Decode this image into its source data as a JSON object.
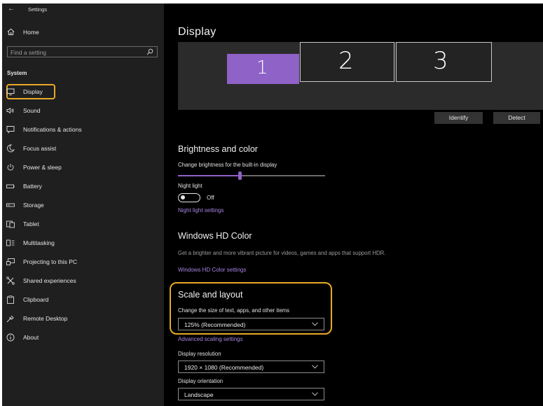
{
  "app": {
    "title": "Settings",
    "back_glyph": "←"
  },
  "sidebar": {
    "home_label": "Home",
    "search_placeholder": "Find a setting",
    "section_label": "System",
    "items": [
      {
        "label": "Display",
        "icon": "monitor-icon",
        "active": true
      },
      {
        "label": "Sound",
        "icon": "speaker-icon"
      },
      {
        "label": "Notifications & actions",
        "icon": "notification-icon"
      },
      {
        "label": "Focus assist",
        "icon": "moon-icon"
      },
      {
        "label": "Power & sleep",
        "icon": "power-icon"
      },
      {
        "label": "Battery",
        "icon": "battery-icon"
      },
      {
        "label": "Storage",
        "icon": "storage-icon"
      },
      {
        "label": "Tablet",
        "icon": "tablet-icon"
      },
      {
        "label": "Multitasking",
        "icon": "multitasking-icon"
      },
      {
        "label": "Projecting to this PC",
        "icon": "projector-icon"
      },
      {
        "label": "Shared experiences",
        "icon": "shared-icon"
      },
      {
        "label": "Clipboard",
        "icon": "clipboard-icon"
      },
      {
        "label": "Remote Desktop",
        "icon": "remote-icon"
      },
      {
        "label": "About",
        "icon": "info-icon"
      }
    ]
  },
  "main": {
    "title": "Display",
    "monitors": [
      "1",
      "2",
      "3"
    ],
    "identify_label": "Identify",
    "detect_label": "Detect",
    "brightness": {
      "heading": "Brightness and color",
      "slider_label": "Change brightness for the built-in display",
      "value_fraction": 0.42,
      "night_light_label": "Night light",
      "night_light_state": "Off",
      "night_light_link": "Night light settings"
    },
    "hdr": {
      "heading": "Windows HD Color",
      "description": "Get a brighter and more vibrant picture for videos, games and apps that support HDR.",
      "link": "Windows HD Color settings"
    },
    "scale": {
      "heading": "Scale and layout",
      "label": "Change the size of text, apps, and other items",
      "value": "125% (Recommended)",
      "advanced_link": "Advanced scaling settings",
      "resolution_label": "Display resolution",
      "resolution_value": "1920 × 1080 (Recommended)",
      "orientation_label": "Display orientation",
      "orientation_value": "Landscape"
    }
  },
  "colors": {
    "accent": "#8f62c7",
    "highlight": "#e8a928",
    "link": "#a784e0"
  }
}
